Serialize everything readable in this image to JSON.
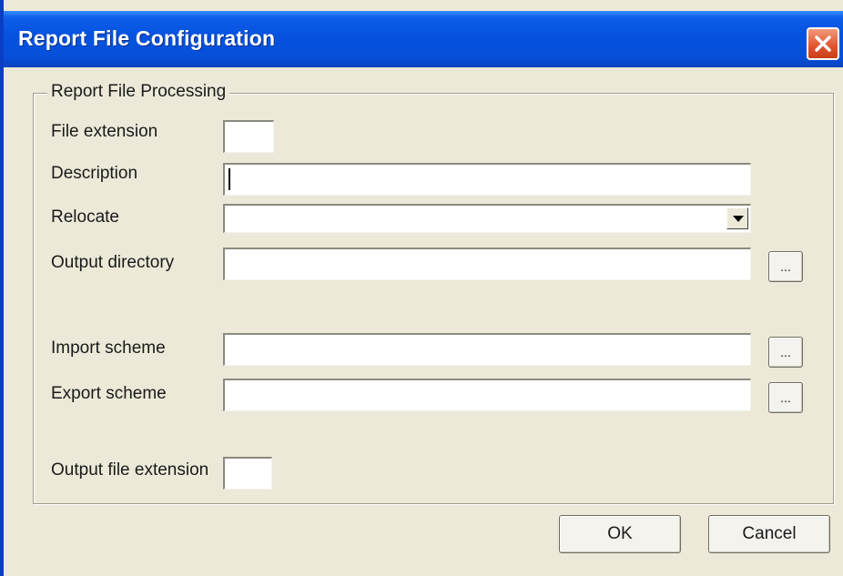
{
  "window": {
    "title": "Report File Configuration",
    "close_icon": "close-icon"
  },
  "group": {
    "legend": "Report File Processing"
  },
  "fields": {
    "file_extension": {
      "label": "File extension",
      "value": ""
    },
    "description": {
      "label": "Description",
      "value": ""
    },
    "relocate": {
      "label": "Relocate",
      "selected": "",
      "arrow_icon": "chevron-down-icon"
    },
    "output_directory": {
      "label": "Output directory",
      "value": "",
      "browse_label": "..."
    },
    "import_scheme": {
      "label": "Import scheme",
      "value": "",
      "browse_label": "..."
    },
    "export_scheme": {
      "label": "Export scheme",
      "value": "",
      "browse_label": "..."
    },
    "output_file_extension": {
      "label": "Output file extension",
      "value": ""
    }
  },
  "buttons": {
    "ok": "OK",
    "cancel": "Cancel"
  },
  "colors": {
    "titlebar": "#0553e0",
    "dialog_bg": "#ece9d8",
    "close_button": "#e0532c"
  }
}
